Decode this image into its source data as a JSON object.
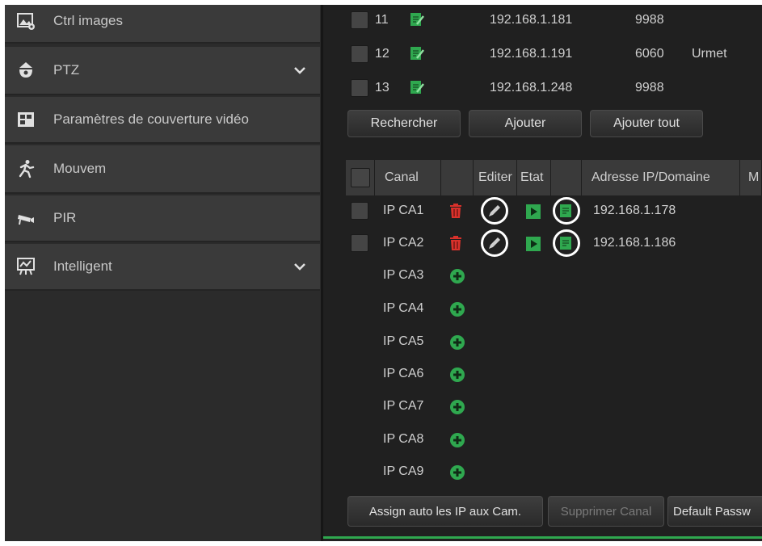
{
  "sidebar": {
    "items": [
      {
        "label": "Ctrl images",
        "icon": "image-settings-icon",
        "expandable": false
      },
      {
        "label": "PTZ",
        "icon": "ptz-camera-icon",
        "expandable": true
      },
      {
        "label": "Paramètres de couverture vidéo",
        "icon": "video-cover-icon",
        "expandable": false
      },
      {
        "label": "Mouvem",
        "icon": "motion-person-icon",
        "expandable": false
      },
      {
        "label": "PIR",
        "icon": "pir-camera-icon",
        "expandable": false
      },
      {
        "label": "Intelligent",
        "icon": "intelligent-easel-icon",
        "expandable": true
      }
    ]
  },
  "search_results": [
    {
      "num": "11",
      "ip": "192.168.1.181",
      "port": "9988",
      "brand": ""
    },
    {
      "num": "12",
      "ip": "192.168.1.191",
      "port": "6060",
      "brand": "Urmet"
    },
    {
      "num": "13",
      "ip": "192.168.1.248",
      "port": "9988",
      "brand": ""
    }
  ],
  "actions": {
    "search": "Rechercher",
    "add": "Ajouter",
    "add_all": "Ajouter tout"
  },
  "channel_table": {
    "headers": {
      "channel": "Canal",
      "edit": "Editer",
      "state": "Etat",
      "ip_domain": "Adresse IP/Domaine",
      "more": "M"
    },
    "rows": [
      {
        "channel": "IP CA1",
        "configured": true,
        "ip": "192.168.1.178"
      },
      {
        "channel": "IP CA2",
        "configured": true,
        "ip": "192.168.1.186"
      },
      {
        "channel": "IP CA3",
        "configured": false,
        "ip": ""
      },
      {
        "channel": "IP CA4",
        "configured": false,
        "ip": ""
      },
      {
        "channel": "IP CA5",
        "configured": false,
        "ip": ""
      },
      {
        "channel": "IP CA6",
        "configured": false,
        "ip": ""
      },
      {
        "channel": "IP CA7",
        "configured": false,
        "ip": ""
      },
      {
        "channel": "IP CA8",
        "configured": false,
        "ip": ""
      },
      {
        "channel": "IP CA9",
        "configured": false,
        "ip": ""
      }
    ]
  },
  "bottom_actions": {
    "assign_auto": "Assign auto les IP aux Cam.",
    "delete_channel": "Supprimer Canal",
    "default_password": "Default Passw"
  },
  "colors": {
    "accent_green": "#2fa84f",
    "delete_red": "#d9312b",
    "highlight_circle": "#ffffff"
  }
}
